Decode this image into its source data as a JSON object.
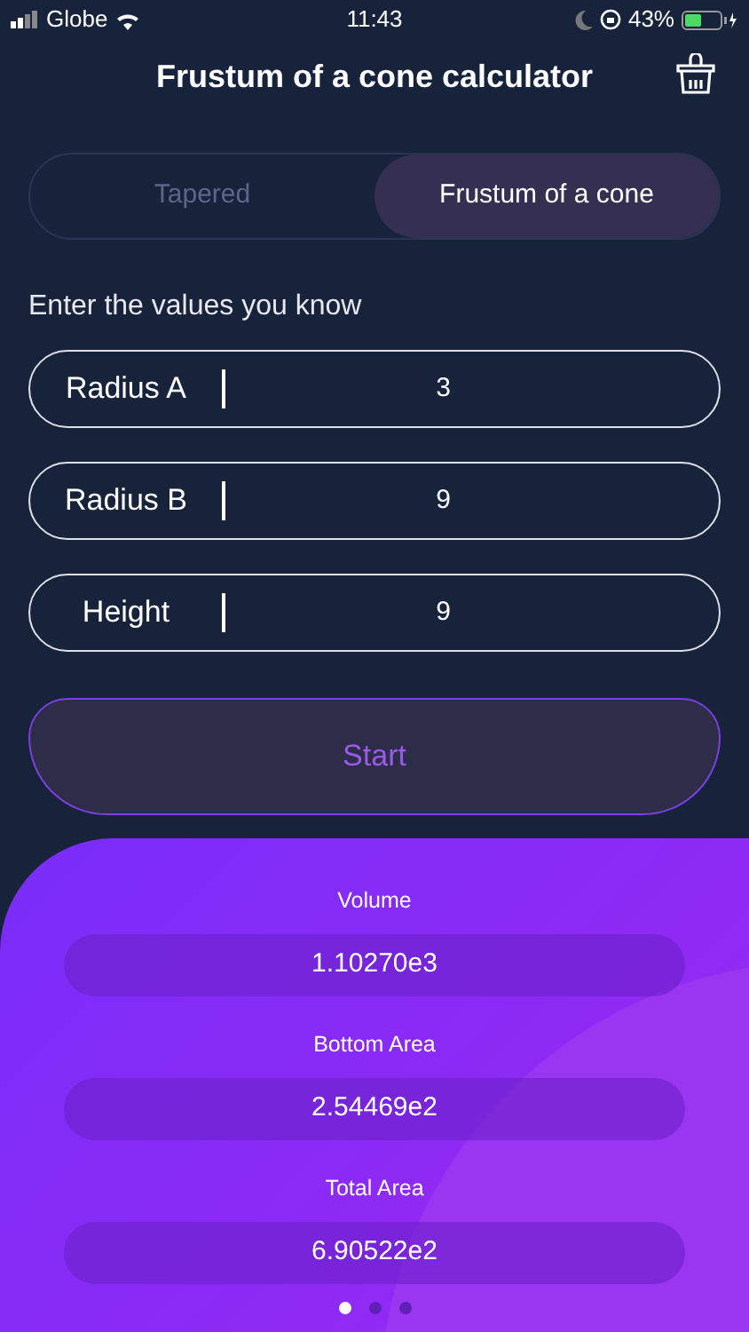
{
  "status_bar": {
    "carrier": "Globe",
    "time": "11:43",
    "battery": "43%"
  },
  "header": {
    "title": "Frustum of a cone calculator"
  },
  "tabs": [
    {
      "label": "Tapered",
      "selected": false
    },
    {
      "label": "Frustum of a cone",
      "selected": true
    }
  ],
  "prompt": "Enter the values you know",
  "fields": [
    {
      "label": "Radius A",
      "value": "3"
    },
    {
      "label": "Radius B",
      "value": "9"
    },
    {
      "label": "Height",
      "value": "9"
    }
  ],
  "start_button": "Start",
  "results": [
    {
      "label": "Volume",
      "value": "1.10270e3"
    },
    {
      "label": "Bottom Area",
      "value": "2.54469e2"
    },
    {
      "label": "Total Area",
      "value": "6.90522e2"
    }
  ],
  "pages": [
    {
      "selected": true
    },
    {
      "selected": false
    },
    {
      "selected": false
    }
  ]
}
